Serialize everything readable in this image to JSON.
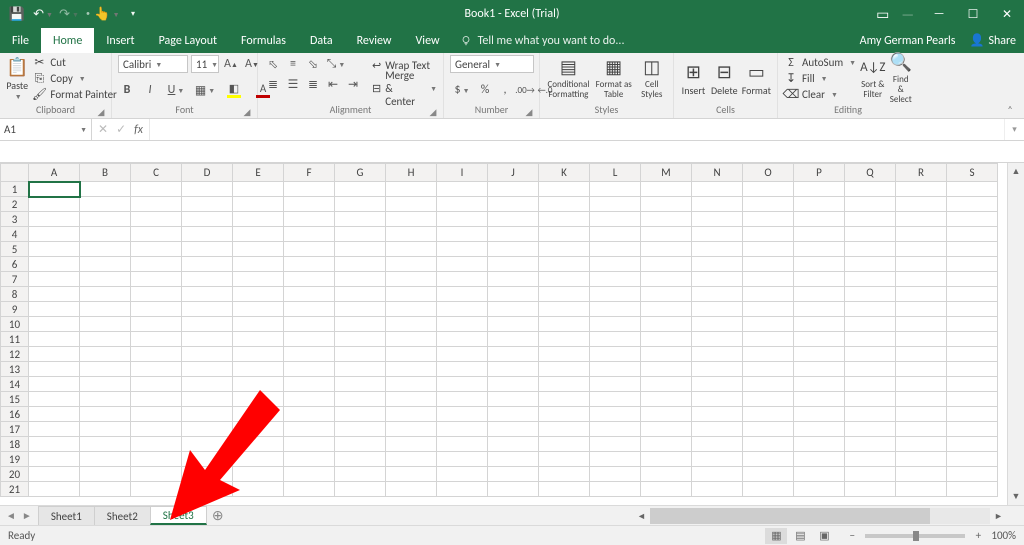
{
  "title": "Book1 - Excel (Trial)",
  "user": {
    "name": "Amy German Pearls",
    "share": "Share"
  },
  "tabs": {
    "file": "File",
    "home": "Home",
    "insert": "Insert",
    "pagelayout": "Page Layout",
    "formulas": "Formulas",
    "data": "Data",
    "review": "Review",
    "view": "View",
    "active": "Home"
  },
  "tellme": "Tell me what you want to do...",
  "ribbon": {
    "clipboard": {
      "label": "Clipboard",
      "paste": "Paste",
      "cut": "Cut",
      "copy": "Copy",
      "formatpainter": "Format Painter"
    },
    "font": {
      "label": "Font",
      "family": "Calibri",
      "size": "11"
    },
    "alignment": {
      "label": "Alignment",
      "wrap": "Wrap Text",
      "merge": "Merge & Center"
    },
    "number": {
      "label": "Number",
      "format": "General"
    },
    "styles": {
      "label": "Styles",
      "cond": "Conditional Formatting",
      "table": "Format as Table",
      "cell": "Cell Styles"
    },
    "cells": {
      "label": "Cells",
      "insert": "Insert",
      "delete": "Delete",
      "format": "Format"
    },
    "editing": {
      "label": "Editing",
      "autosum": "AutoSum",
      "fill": "Fill",
      "clear": "Clear",
      "sort": "Sort & Filter",
      "find": "Find & Select"
    }
  },
  "namebox": "A1",
  "columns": [
    "A",
    "B",
    "C",
    "D",
    "E",
    "F",
    "G",
    "H",
    "I",
    "J",
    "K",
    "L",
    "M",
    "N",
    "O",
    "P",
    "Q",
    "R",
    "S"
  ],
  "rowcount": 21,
  "selected": {
    "col": "A",
    "row": 1
  },
  "sheets": {
    "list": [
      "Sheet1",
      "Sheet2",
      "Sheet3"
    ],
    "active": "Sheet3"
  },
  "status": {
    "ready": "Ready",
    "zoom": "100%"
  }
}
